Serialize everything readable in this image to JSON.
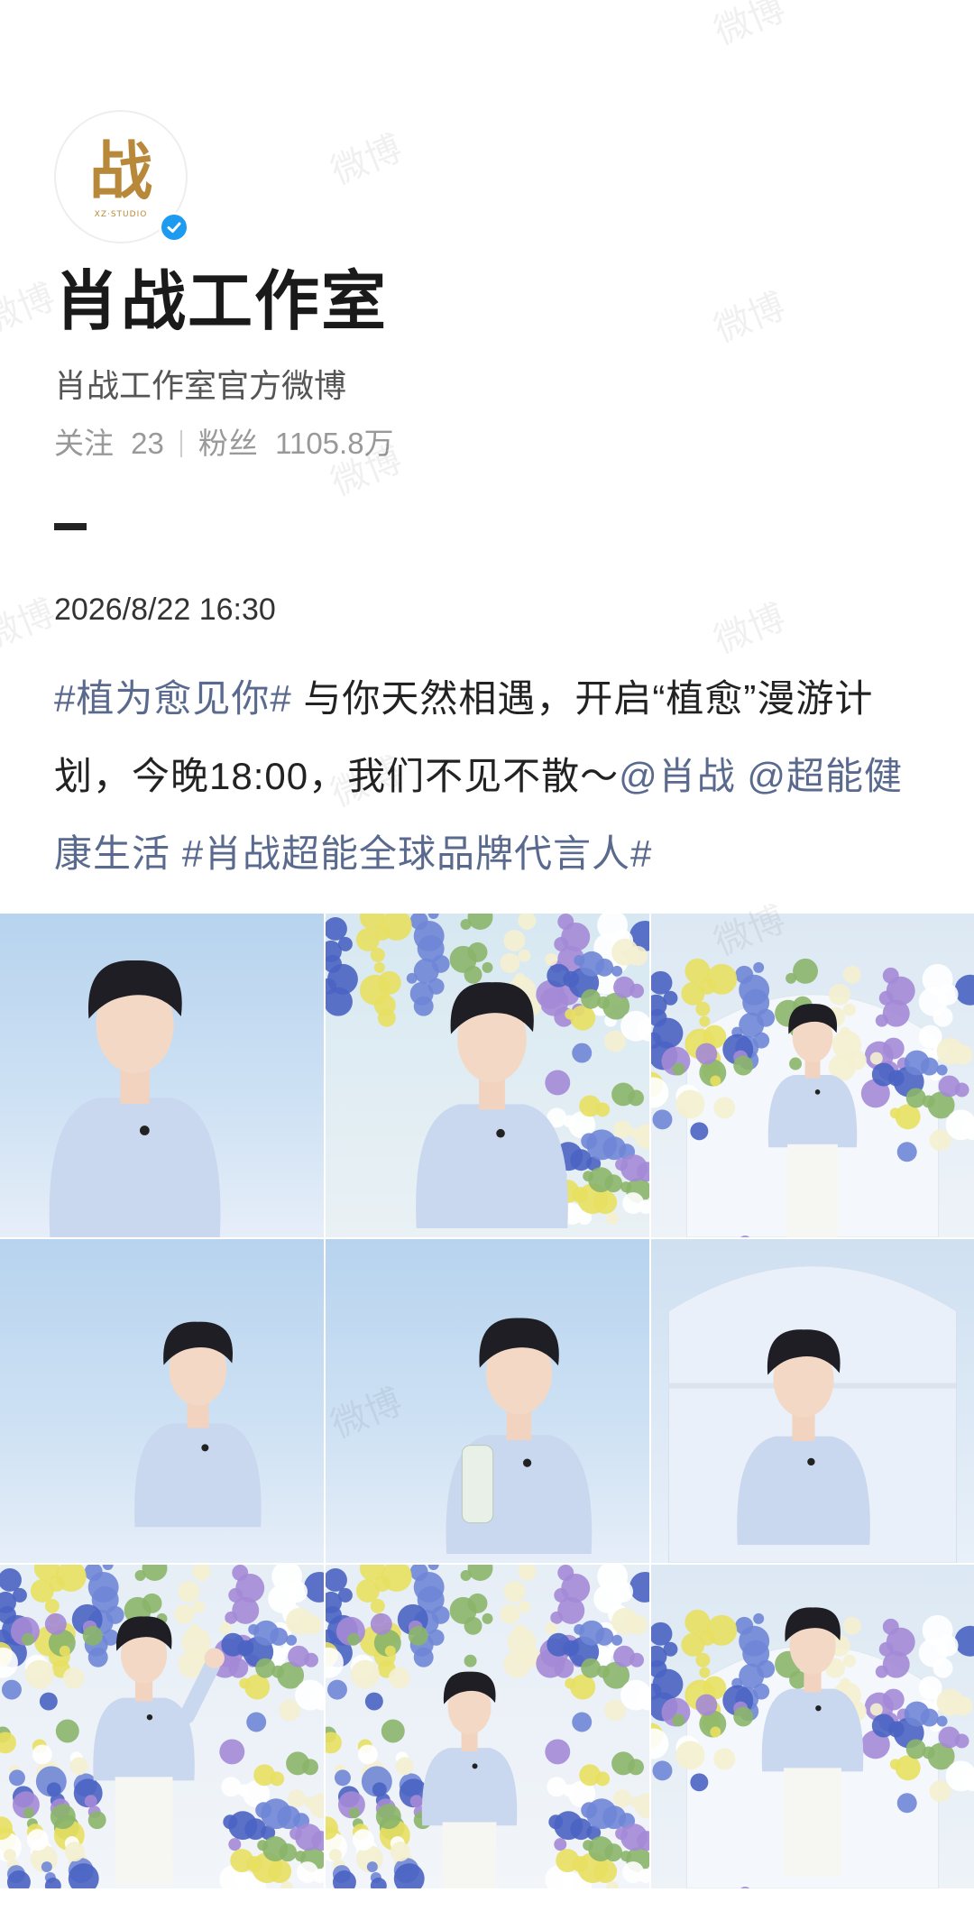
{
  "profile": {
    "avatar_text": "战",
    "avatar_subtext": "XZ·STUDIO",
    "name": "肖战工作室",
    "description": "肖战工作室官方微博",
    "following_label": "关注",
    "following_count": "23",
    "followers_label": "粉丝",
    "followers_count": "1105.8万"
  },
  "post": {
    "timestamp": "2026/8/22 16:30",
    "segments": [
      {
        "type": "tag",
        "text": "#植为愈见你#"
      },
      {
        "type": "text",
        "text": " 与你天然相遇，开启“植愈”漫游计划，今晚18:00，我们不见不散～"
      },
      {
        "type": "mention",
        "text": "@肖战"
      },
      {
        "type": "text",
        "text": " "
      },
      {
        "type": "mention",
        "text": "@超能健康生活"
      },
      {
        "type": "text",
        "text": " "
      },
      {
        "type": "tag",
        "text": "#肖战超能全球品牌代言人#"
      }
    ]
  },
  "watermark_text": "微博",
  "colors": {
    "link": "#5a6a8e",
    "verified": "#1d9bf0",
    "avatar_gold": "#b8893a"
  },
  "photos": [
    {
      "name": "photo-portrait-closeup",
      "scene": "sky",
      "pose": "bust-left"
    },
    {
      "name": "photo-portrait-flowers",
      "scene": "flowers",
      "pose": "bust-center"
    },
    {
      "name": "photo-standing-flower-arch",
      "scene": "arch",
      "pose": "standing-small"
    },
    {
      "name": "photo-leaning-pouring",
      "scene": "sky",
      "pose": "leaning"
    },
    {
      "name": "photo-holding-bottle",
      "scene": "sky",
      "pose": "bust-bottle"
    },
    {
      "name": "photo-shelf-smiling",
      "scene": "shelf",
      "pose": "bust-center-low"
    },
    {
      "name": "photo-waving",
      "scene": "flowers-wide",
      "pose": "standing-wave"
    },
    {
      "name": "photo-looking-down",
      "scene": "flowers-wide",
      "pose": "standing-down"
    },
    {
      "name": "photo-standing-right",
      "scene": "arch",
      "pose": "standing-center"
    }
  ]
}
